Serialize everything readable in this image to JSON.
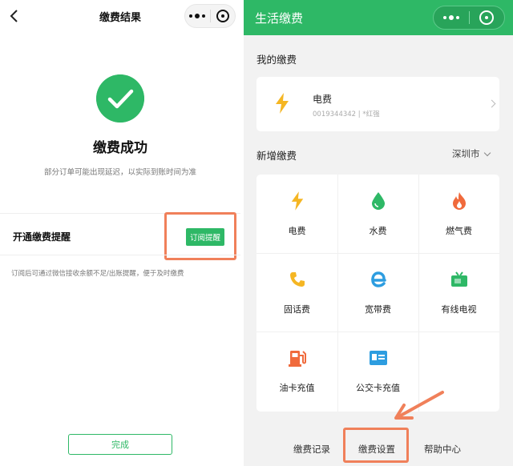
{
  "left": {
    "nav": {
      "title": "缴费结果"
    },
    "result": {
      "title": "缴费成功",
      "note": "部分订单可能出现延迟，以实际到账时间为准"
    },
    "reminder": {
      "label": "开通缴费提醒",
      "button": "订阅提醒",
      "note": "订阅后可通过微信接收余额不足/出账提醒，便于及时缴费"
    },
    "done_button": "完成"
  },
  "right": {
    "header": {
      "title": "生活缴费"
    },
    "my_bills": {
      "title": "我的缴费",
      "card": {
        "name": "电费",
        "sub": "0019344342 | *红强",
        "icon": "lightning-icon"
      }
    },
    "new_bills": {
      "title": "新增缴费",
      "city": "深圳市",
      "items": [
        {
          "label": "电费",
          "icon": "lightning-icon",
          "color": "#f5b623"
        },
        {
          "label": "水费",
          "icon": "water-drop-icon",
          "color": "#2eb866"
        },
        {
          "label": "燃气费",
          "icon": "flame-icon",
          "color": "#f06a3c"
        },
        {
          "label": "固话费",
          "icon": "phone-icon",
          "color": "#f5b623"
        },
        {
          "label": "宽带费",
          "icon": "broadband-e-icon",
          "color": "#2d9de0"
        },
        {
          "label": "有线电视",
          "icon": "tv-icon",
          "color": "#2eb866"
        },
        {
          "label": "油卡充值",
          "icon": "fuel-pump-icon",
          "color": "#f06a3c"
        },
        {
          "label": "公交卡充值",
          "icon": "bus-card-icon",
          "color": "#2d9de0"
        }
      ]
    },
    "tabs": [
      {
        "label": "缴费记录"
      },
      {
        "label": "缴费设置"
      },
      {
        "label": "帮助中心"
      }
    ]
  },
  "colors": {
    "brand_green": "#2eb866",
    "highlight": "#f0805a"
  }
}
